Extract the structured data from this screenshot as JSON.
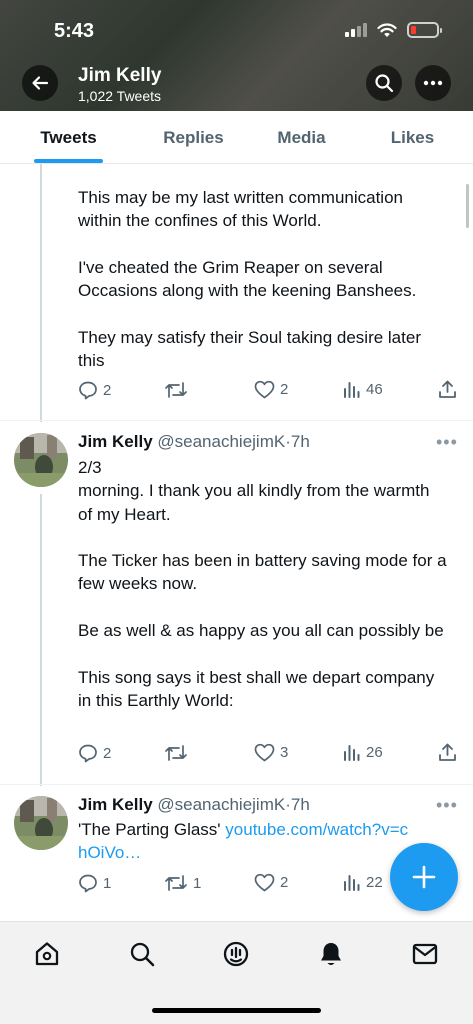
{
  "status_bar": {
    "time": "5:43"
  },
  "header": {
    "name": "Jim Kelly",
    "tweet_count": "1,022 Tweets"
  },
  "tabs": [
    {
      "label": "Tweets",
      "active": true
    },
    {
      "label": "Replies",
      "active": false
    },
    {
      "label": "Media",
      "active": false
    },
    {
      "label": "Likes",
      "active": false
    }
  ],
  "tweets": [
    {
      "text": "This may be my last written communication within the confines of this World.\n\nI've cheated the Grim Reaper on several Occasions along with the keening Banshees.\n\nThey may satisfy their Soul taking desire later this",
      "replies": "2",
      "retweets": "",
      "likes": "2",
      "views": "46"
    },
    {
      "name": "Jim Kelly",
      "handle": "@seanachiejimK",
      "time": "7h",
      "text": "2/3\nmorning. I thank you all kindly from the warmth of my Heart.\n\nThe Ticker has been in battery saving mode for a few weeks now.\n\nBe as well & as happy as you all can possibly be\n\nThis song says it best shall we depart company in this Earthly World:",
      "replies": "2",
      "retweets": "",
      "likes": "3",
      "views": "26"
    },
    {
      "name": "Jim Kelly",
      "handle": "@seanachiejimK",
      "time": "7h",
      "text_prefix": "'The Parting Glass' ",
      "link_text": "youtube.com/watch?v=chOiVo…",
      "replies": "1",
      "retweets": "1",
      "likes": "2",
      "views": "22"
    }
  ],
  "colors": {
    "accent": "#1d9bf0",
    "text": "#0f1419",
    "secondary": "#536471"
  },
  "icons": {
    "header": [
      "back-arrow-icon",
      "search-icon",
      "more-icon"
    ],
    "actions": [
      "reply-icon",
      "retweet-icon",
      "like-icon",
      "views-icon",
      "share-icon"
    ],
    "bottom_nav": [
      "home-icon",
      "search-icon",
      "spaces-icon",
      "notifications-icon",
      "messages-icon"
    ],
    "fab": "compose-plus-icon"
  }
}
